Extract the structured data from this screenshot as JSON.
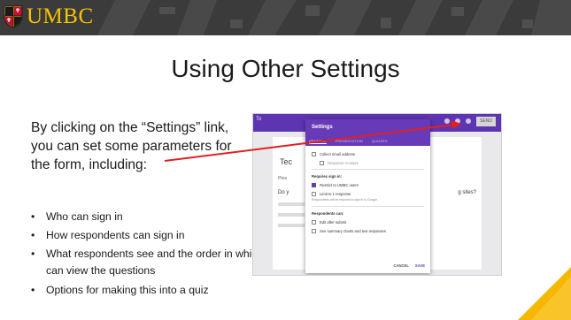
{
  "logo": {
    "text": "UMBC"
  },
  "slide": {
    "title": "Using Other Settings",
    "intro": "By clicking on the “Settings” link, you can set some parameters for the form, including:",
    "bullets": [
      "Who can sign in",
      "How respondents can sign in",
      "What respondents see and the order in which they can view the questions",
      "Options for making this into a quiz"
    ]
  },
  "screenshot": {
    "app_title": "To",
    "send_label": "SEND",
    "bg_form": {
      "title_fragment": "Tec",
      "field_fragment": "Plea",
      "question_fragment": "Do y",
      "answer_fragment": "g sites?"
    },
    "dialog": {
      "title": "Settings",
      "tabs": [
        "GENERAL",
        "PRESENTATION",
        "QUIZZES"
      ],
      "options": {
        "collect_email": "Collect email address",
        "response_receipts": "Response receipts",
        "requires_sign_in": "Requires sign in:",
        "restrict_umbc": "Restrict to UMBC users",
        "limit_one": "Limit to 1 response",
        "limit_note": "Respondents will be required to sign in to Google.",
        "respondents_can": "Respondents can:",
        "edit_after": "Edit after submit",
        "see_summary": "See summary charts and text responses"
      },
      "cancel_label": "CANCEL",
      "save_label": "SAVE"
    }
  },
  "colors": {
    "banner": "#3b3b3b",
    "logo_gold": "#f5c400",
    "logo_red": "#c8102e",
    "forms_purple": "#673ab7",
    "arrow_red": "#e02020",
    "corner_yellow": "#f5b700"
  }
}
